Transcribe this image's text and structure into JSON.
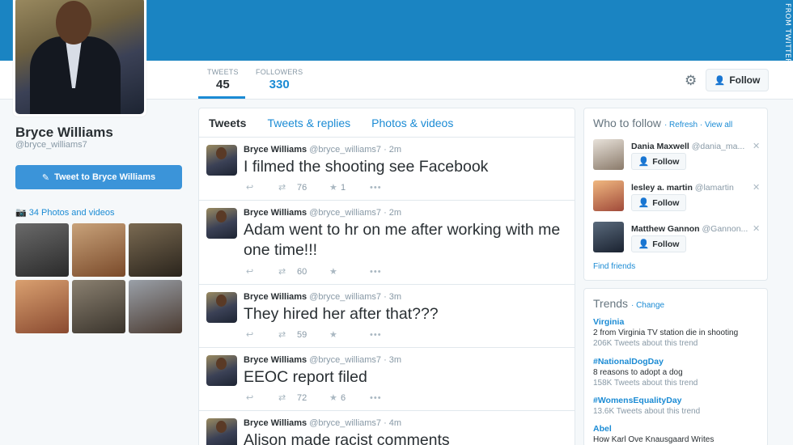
{
  "watermark": "FROM TWITTER",
  "profile": {
    "name": "Bryce Williams",
    "handle": "@bryce_williams7",
    "tweet_to_label": "Tweet to Bryce Williams",
    "photos_label": "34 Photos and videos"
  },
  "stats": {
    "tweets_label": "TWEETS",
    "tweets_value": "45",
    "followers_label": "FOLLOWERS",
    "followers_value": "330"
  },
  "follow_label": "Follow",
  "tabs": [
    "Tweets",
    "Tweets & replies",
    "Photos & videos"
  ],
  "tweets": [
    {
      "name": "Bryce Williams",
      "handle": "@bryce_williams7 · 2m",
      "text": "I filmed the shooting see Facebook",
      "retweets": "76",
      "favorites": "1"
    },
    {
      "name": "Bryce Williams",
      "handle": "@bryce_williams7 · 2m",
      "text": "Adam went to hr on me after working with me one time!!!",
      "retweets": "60",
      "favorites": ""
    },
    {
      "name": "Bryce Williams",
      "handle": "@bryce_williams7 · 3m",
      "text": "They hired her after that???",
      "retweets": "59",
      "favorites": ""
    },
    {
      "name": "Bryce Williams",
      "handle": "@bryce_williams7 · 3m",
      "text": "EEOC report filed",
      "retweets": "72",
      "favorites": "6"
    },
    {
      "name": "Bryce Williams",
      "handle": "@bryce_williams7 · 4m",
      "text": "Alison made racist comments",
      "retweets": "",
      "favorites": ""
    }
  ],
  "who_to_follow": {
    "title": "Who to follow",
    "refresh": "Refresh",
    "view_all": "View all",
    "follow_label": "Follow",
    "find_friends": "Find friends",
    "suggestions": [
      {
        "name": "Dania Maxwell",
        "handle": "@dania_ma...",
        "color": "#c9c2b8"
      },
      {
        "name": "lesley a. martin",
        "handle": "@lamartin",
        "color": "#c98a5a"
      },
      {
        "name": "Matthew Gannon",
        "handle": "@Gannon...",
        "color": "#2c3a4c"
      }
    ]
  },
  "trends": {
    "title": "Trends",
    "change": "Change",
    "items": [
      {
        "name": "Virginia",
        "desc": "2 from Virginia TV station die in shooting",
        "count": "206K Tweets about this trend"
      },
      {
        "name": "#NationalDogDay",
        "desc": "8 reasons to adopt a dog",
        "count": "158K Tweets about this trend"
      },
      {
        "name": "#WomensEqualityDay",
        "desc": "",
        "count": "13.6K Tweets about this trend"
      },
      {
        "name": "Abel",
        "desc": "How Karl Ove Knausgaard Writes",
        "count": ""
      }
    ]
  },
  "colors": {
    "header": "#1a84c2",
    "accent": "#1b8bd4",
    "tweet_button": "#3b94d9"
  }
}
